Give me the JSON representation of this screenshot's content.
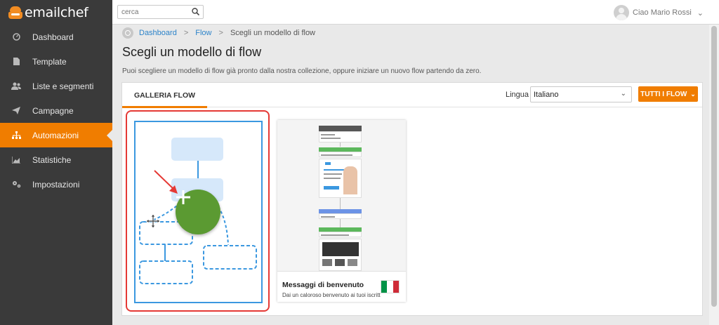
{
  "brand": {
    "name": "emailchef",
    "accent": "#f07d00",
    "link": "#2c83c9"
  },
  "sidebar": {
    "items": [
      {
        "label": "Dashboard",
        "icon": "dashboard-icon"
      },
      {
        "label": "Template",
        "icon": "document-icon"
      },
      {
        "label": "Liste e segmenti",
        "icon": "users-icon"
      },
      {
        "label": "Campagne",
        "icon": "paper-plane-icon"
      },
      {
        "label": "Automazioni",
        "icon": "sitemap-icon",
        "active": true
      },
      {
        "label": "Statistiche",
        "icon": "chart-icon"
      },
      {
        "label": "Impostazioni",
        "icon": "gears-icon"
      }
    ]
  },
  "topbar": {
    "search_placeholder": "cerca",
    "user_label": "Ciao Mario Rossi"
  },
  "breadcrumb": {
    "items": [
      "Dashboard",
      "Flow",
      "Scegli un modello di flow"
    ]
  },
  "page": {
    "title": "Scegli un modello di flow",
    "subtitle": "Puoi scegliere un modello di flow già pronto dalla nostra collezione, oppure iniziare un nuovo flow partendo da zero."
  },
  "gallery": {
    "tab_label": "GALLERIA FLOW",
    "language_label": "Lingua",
    "language_value": "Italiano",
    "filter_button": "TUTTI I FLOW"
  },
  "templates": [
    {
      "name": "Messaggi di benvenuto",
      "description": "Dai un caloroso benvenuto ai tuoi iscritti",
      "flag": "italy-flag",
      "flag_colors": [
        "#009246",
        "#ffffff",
        "#ce2b37"
      ]
    }
  ]
}
